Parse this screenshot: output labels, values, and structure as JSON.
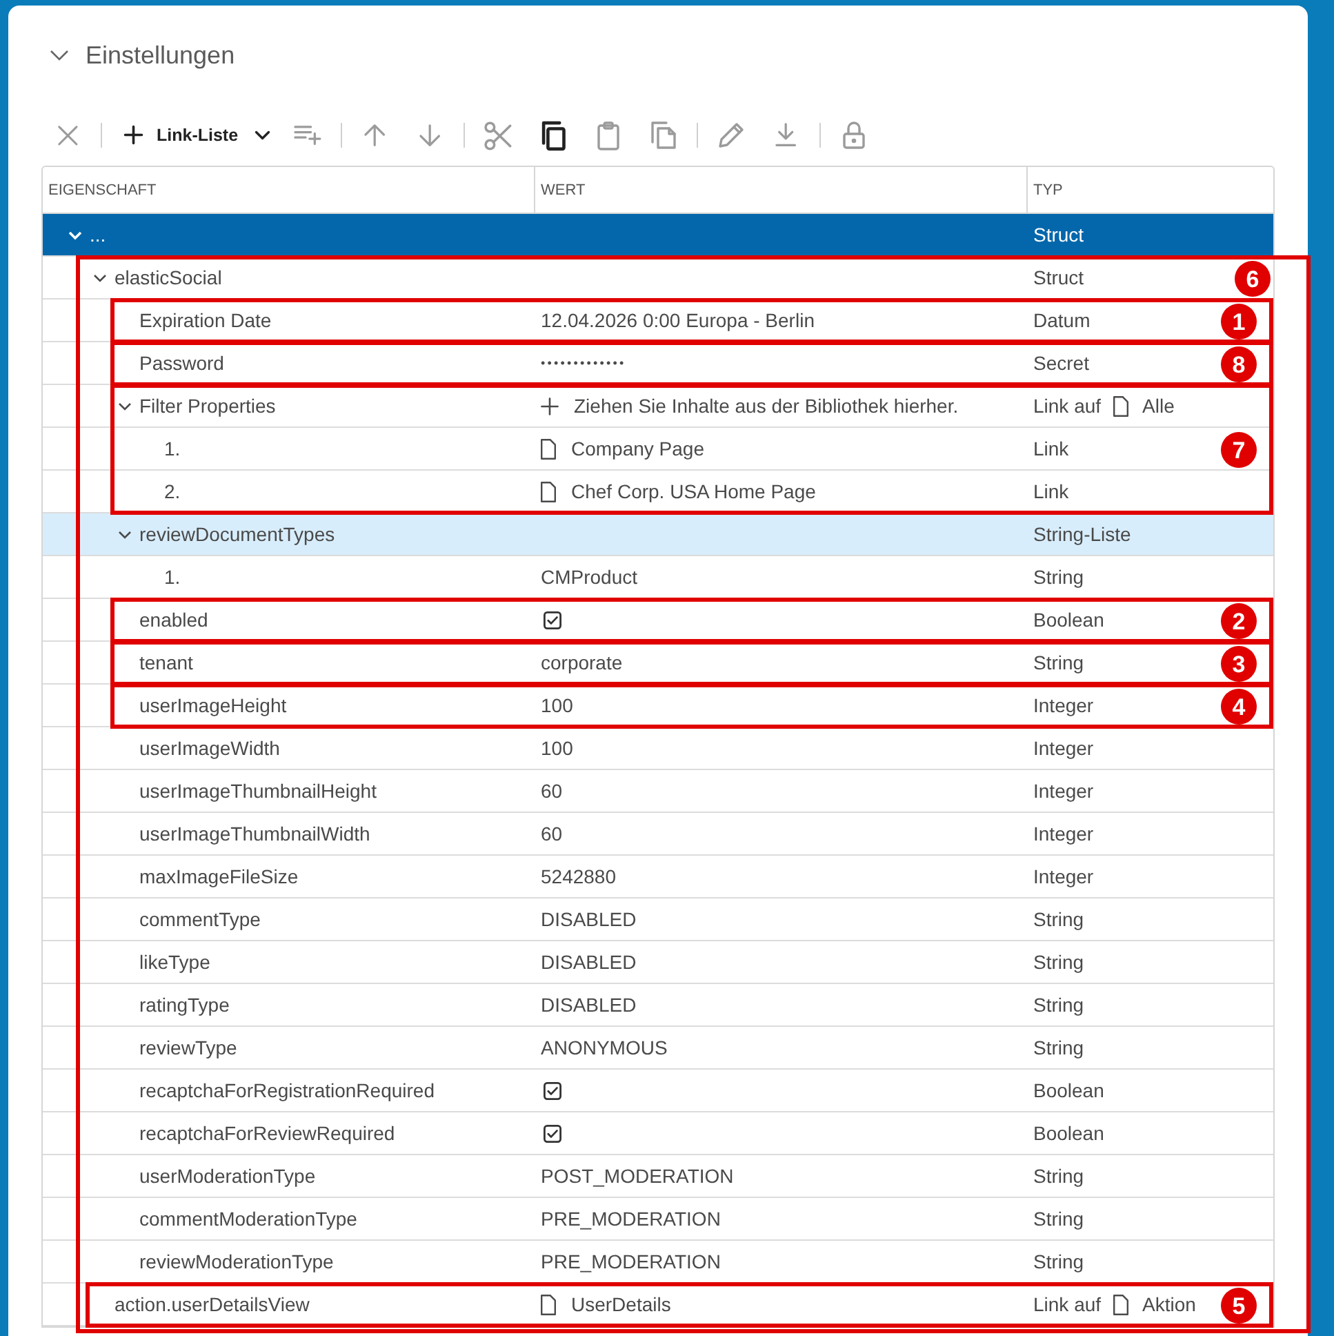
{
  "panel": {
    "title": "Einstellungen",
    "expanded": true
  },
  "toolbar": [
    {
      "kind": "button",
      "disabled": true
    },
    {
      "kind": "separator"
    },
    {
      "kind": "menu",
      "label": "Link-Liste",
      "disabled": false
    },
    {
      "kind": "button",
      "disabled": true
    },
    {
      "kind": "separator"
    },
    {
      "kind": "button",
      "disabled": true
    },
    {
      "kind": "button",
      "disabled": true
    },
    {
      "kind": "separator"
    },
    {
      "kind": "button",
      "disabled": true
    },
    {
      "kind": "button",
      "disabled": false
    },
    {
      "kind": "button",
      "disabled": true
    },
    {
      "kind": "button",
      "disabled": true
    },
    {
      "kind": "separator"
    },
    {
      "kind": "button",
      "disabled": true
    },
    {
      "kind": "button",
      "disabled": true
    },
    {
      "kind": "separator"
    },
    {
      "kind": "button",
      "disabled": true
    }
  ],
  "table": {
    "columns": [
      "EIGENSCHAFT",
      "WERT",
      "TYP"
    ],
    "tree": {
      "name": "...",
      "type": {
        "kind": "text",
        "text": "Struct"
      },
      "selected": true,
      "hovered": false,
      "expanded": true,
      "children_callout": "6",
      "children": [
        {
          "name": "elasticSocial",
          "type": {
            "kind": "text",
            "text": "Struct"
          },
          "selected": false,
          "hovered": false,
          "expanded": true,
          "children": [
            {
              "name": "Expiration Date",
              "value": {
                "kind": "text",
                "text": "12.04.2026 0:00 Europa - Berlin"
              },
              "type": {
                "kind": "text",
                "text": "Datum"
              },
              "selected": false,
              "hovered": false,
              "callout": "1"
            },
            {
              "name": "Password",
              "value": {
                "kind": "secret",
                "text": "•••••••••••••"
              },
              "type": {
                "kind": "text",
                "text": "Secret"
              },
              "selected": false,
              "hovered": false,
              "callout": "8"
            },
            {
              "name": "Filter Properties",
              "value": {
                "kind": "drop",
                "text": "Ziehen Sie Inhalte aus der Bibliothek hierher."
              },
              "type": {
                "kind": "link",
                "text": "Link auf",
                "target": "Alle"
              },
              "selected": false,
              "hovered": false,
              "expanded": true,
              "callout": "7",
              "children": [
                {
                  "name": "1.",
                  "value": {
                    "kind": "link",
                    "text": "Company Page"
                  },
                  "type": {
                    "kind": "text",
                    "text": "Link"
                  },
                  "selected": false,
                  "hovered": false
                },
                {
                  "name": "2.",
                  "value": {
                    "kind": "link",
                    "text": "Chef Corp. USA Home Page"
                  },
                  "type": {
                    "kind": "text",
                    "text": "Link"
                  },
                  "selected": false,
                  "hovered": false
                }
              ]
            },
            {
              "name": "reviewDocumentTypes",
              "type": {
                "kind": "text",
                "text": "String-Liste"
              },
              "selected": false,
              "hovered": true,
              "expanded": true,
              "children": [
                {
                  "name": "1.",
                  "value": {
                    "kind": "text",
                    "text": "CMProduct"
                  },
                  "type": {
                    "kind": "text",
                    "text": "String"
                  },
                  "selected": false,
                  "hovered": false
                }
              ]
            },
            {
              "name": "enabled",
              "value": {
                "kind": "checkbox",
                "checked": true
              },
              "type": {
                "kind": "text",
                "text": "Boolean"
              },
              "selected": false,
              "hovered": false,
              "callout": "2"
            },
            {
              "name": "tenant",
              "value": {
                "kind": "text",
                "text": "corporate"
              },
              "type": {
                "kind": "text",
                "text": "String"
              },
              "selected": false,
              "hovered": false,
              "callout": "3"
            },
            {
              "name": "userImageHeight",
              "value": {
                "kind": "text",
                "text": "100"
              },
              "type": {
                "kind": "text",
                "text": "Integer"
              },
              "selected": false,
              "hovered": false,
              "callout": "4"
            },
            {
              "name": "userImageWidth",
              "value": {
                "kind": "text",
                "text": "100"
              },
              "type": {
                "kind": "text",
                "text": "Integer"
              },
              "selected": false,
              "hovered": false
            },
            {
              "name": "userImageThumbnailHeight",
              "value": {
                "kind": "text",
                "text": "60"
              },
              "type": {
                "kind": "text",
                "text": "Integer"
              },
              "selected": false,
              "hovered": false
            },
            {
              "name": "userImageThumbnailWidth",
              "value": {
                "kind": "text",
                "text": "60"
              },
              "type": {
                "kind": "text",
                "text": "Integer"
              },
              "selected": false,
              "hovered": false
            },
            {
              "name": "maxImageFileSize",
              "value": {
                "kind": "text",
                "text": "5242880"
              },
              "type": {
                "kind": "text",
                "text": "Integer"
              },
              "selected": false,
              "hovered": false
            },
            {
              "name": "commentType",
              "value": {
                "kind": "text",
                "text": "DISABLED"
              },
              "type": {
                "kind": "text",
                "text": "String"
              },
              "selected": false,
              "hovered": false
            },
            {
              "name": "likeType",
              "value": {
                "kind": "text",
                "text": "DISABLED"
              },
              "type": {
                "kind": "text",
                "text": "String"
              },
              "selected": false,
              "hovered": false
            },
            {
              "name": "ratingType",
              "value": {
                "kind": "text",
                "text": "DISABLED"
              },
              "type": {
                "kind": "text",
                "text": "String"
              },
              "selected": false,
              "hovered": false
            },
            {
              "name": "reviewType",
              "value": {
                "kind": "text",
                "text": "ANONYMOUS"
              },
              "type": {
                "kind": "text",
                "text": "String"
              },
              "selected": false,
              "hovered": false
            },
            {
              "name": "recaptchaForRegistrationRequired",
              "value": {
                "kind": "checkbox",
                "checked": true
              },
              "type": {
                "kind": "text",
                "text": "Boolean"
              },
              "selected": false,
              "hovered": false
            },
            {
              "name": "recaptchaForReviewRequired",
              "value": {
                "kind": "checkbox",
                "checked": true
              },
              "type": {
                "kind": "text",
                "text": "Boolean"
              },
              "selected": false,
              "hovered": false
            },
            {
              "name": "userModerationType",
              "value": {
                "kind": "text",
                "text": "POST_MODERATION"
              },
              "type": {
                "kind": "text",
                "text": "String"
              },
              "selected": false,
              "hovered": false
            },
            {
              "name": "commentModerationType",
              "value": {
                "kind": "text",
                "text": "PRE_MODERATION"
              },
              "type": {
                "kind": "text",
                "text": "String"
              },
              "selected": false,
              "hovered": false
            },
            {
              "name": "reviewModerationType",
              "value": {
                "kind": "text",
                "text": "PRE_MODERATION"
              },
              "type": {
                "kind": "text",
                "text": "String"
              },
              "selected": false,
              "hovered": false
            }
          ]
        },
        {
          "name": "action.userDetailsView",
          "value": {
            "kind": "link",
            "text": "UserDetails"
          },
          "type": {
            "kind": "link",
            "text": "Link auf",
            "target": "Aktion"
          },
          "selected": false,
          "hovered": false,
          "callout": "5"
        }
      ]
    }
  }
}
